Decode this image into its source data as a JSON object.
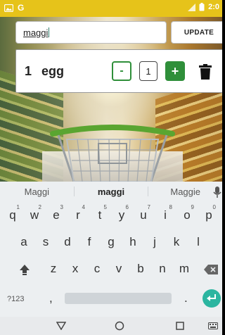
{
  "status_bar": {
    "app_letter": "G",
    "time": "2:0",
    "color": "#e6c31a"
  },
  "search": {
    "value": "maggi",
    "update_label": "UPDATE"
  },
  "item": {
    "quantity": "1",
    "name": "egg",
    "minus_label": "-",
    "stepper_value": "1",
    "plus_label": "+",
    "accent": "#2f8f3a"
  },
  "keyboard": {
    "suggestions": [
      "Maggi",
      "maggi",
      "Maggie"
    ],
    "row1": [
      {
        "k": "q",
        "h": "1"
      },
      {
        "k": "w",
        "h": "2"
      },
      {
        "k": "e",
        "h": "3"
      },
      {
        "k": "r",
        "h": "4"
      },
      {
        "k": "t",
        "h": "5"
      },
      {
        "k": "y",
        "h": "6"
      },
      {
        "k": "u",
        "h": "7"
      },
      {
        "k": "i",
        "h": "8"
      },
      {
        "k": "o",
        "h": "9"
      },
      {
        "k": "p",
        "h": "0"
      }
    ],
    "row2": [
      "a",
      "s",
      "d",
      "f",
      "g",
      "h",
      "j",
      "k",
      "l"
    ],
    "row3": [
      "z",
      "x",
      "c",
      "v",
      "b",
      "n",
      "m"
    ],
    "symbols_label": "?123",
    "comma": ",",
    "period": "."
  }
}
